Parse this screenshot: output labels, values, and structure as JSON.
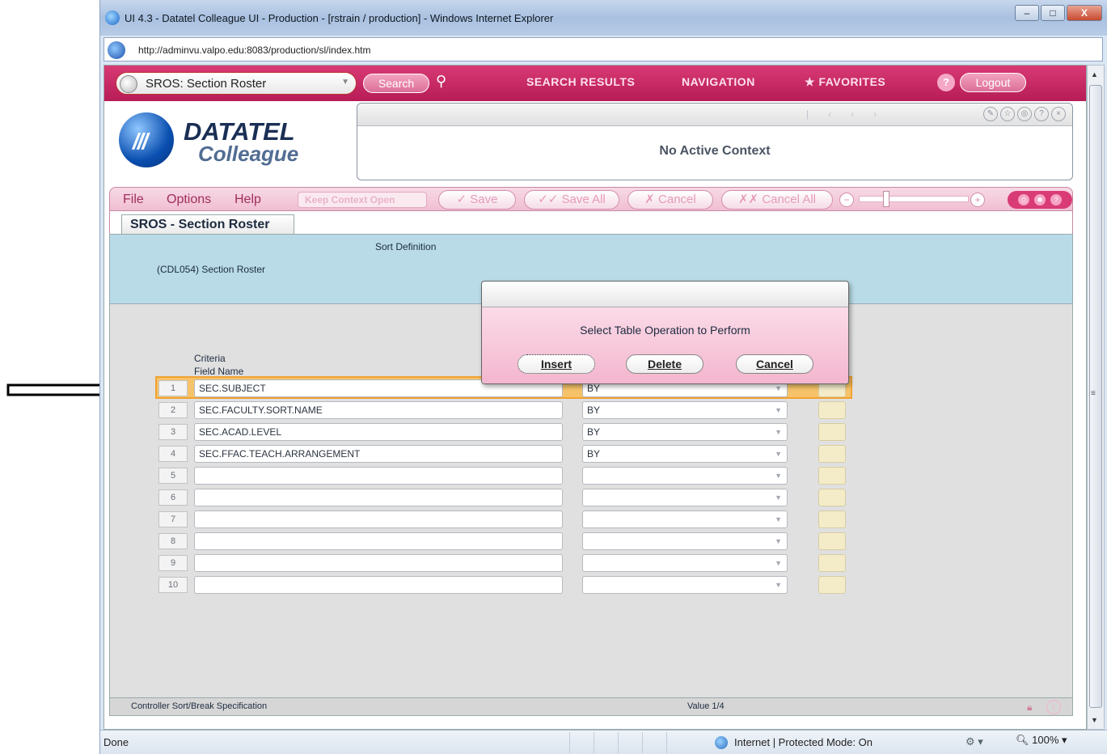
{
  "window": {
    "title": "UI 4.3 - Datatel Colleague UI - Production - [rstrain / production] - Windows Internet Explorer",
    "url": "http://adminvu.valpo.edu:8083/production/sl/index.htm",
    "min_label": "–",
    "max_label": "□",
    "close_label": "X"
  },
  "header": {
    "screen_select": "SROS: Section Roster",
    "search_label": "Search",
    "nav": [
      "SEARCH RESULTS",
      "NAVIGATION",
      "FAVORITES"
    ],
    "help_label": "?",
    "logout_label": "Logout"
  },
  "logo": {
    "line1": "DATATEL",
    "line2": "Colleague"
  },
  "context": {
    "text": "No Active Context"
  },
  "menu": {
    "file": "File",
    "options": "Options",
    "help": "Help",
    "keep_context": "Keep Context Open",
    "save": "✓ Save",
    "save_all": "✓✓ Save All",
    "cancel": "✗ Cancel",
    "cancel_all": "✗✗ Cancel All"
  },
  "tab": {
    "label": "SROS - Section Roster"
  },
  "form": {
    "sort_definition": "Sort Definition",
    "program": "(CDL054) Section Roster",
    "col_criteria": "Criteria",
    "col_field_name": "Field Name",
    "rows": [
      {
        "num": "1",
        "field": "SEC.SUBJECT",
        "sort": "BY"
      },
      {
        "num": "2",
        "field": "SEC.FACULTY.SORT.NAME",
        "sort": "BY"
      },
      {
        "num": "3",
        "field": "SEC.ACAD.LEVEL",
        "sort": "BY"
      },
      {
        "num": "4",
        "field": "SEC.FFAC.TEACH.ARRANGEMENT",
        "sort": "BY"
      },
      {
        "num": "5",
        "field": "",
        "sort": ""
      },
      {
        "num": "6",
        "field": "",
        "sort": ""
      },
      {
        "num": "7",
        "field": "",
        "sort": ""
      },
      {
        "num": "8",
        "field": "",
        "sort": ""
      },
      {
        "num": "9",
        "field": "",
        "sort": ""
      },
      {
        "num": "10",
        "field": "",
        "sort": ""
      }
    ],
    "status_left": "Controller Sort/Break Specification",
    "status_mid": "Value 1/4"
  },
  "dialog": {
    "message": "Select Table Operation to Perform",
    "insert": "Insert",
    "delete": "Delete",
    "cancel": "Cancel"
  },
  "statusbar": {
    "done": "Done",
    "zone": "Internet | Protected Mode: On",
    "zoom": "100%"
  }
}
